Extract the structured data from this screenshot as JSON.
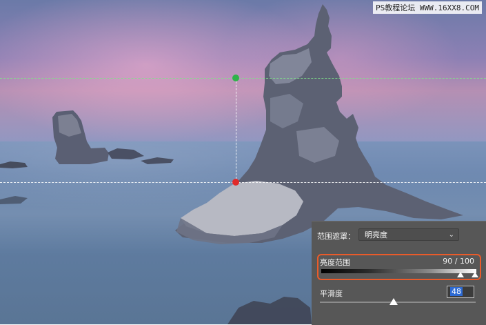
{
  "watermark": "PS教程论坛 WWW.16XX8.COM",
  "guides": {
    "upper_line_color": "#7fe38a",
    "lower_line_color": "#ffffff",
    "upper_point_color": "#2fb34a",
    "lower_point_color": "#e02a2a"
  },
  "panel": {
    "range_mask_label": "范围遮罩：",
    "range_mask_value": "明亮度",
    "range_mask_icon": "chevron-down-icon",
    "brightness_label": "亮度范围",
    "brightness_value": "90 / 100",
    "highlight_color": "#ea5b2a",
    "smoothness_label": "平滑度",
    "smoothness_value": "48"
  }
}
